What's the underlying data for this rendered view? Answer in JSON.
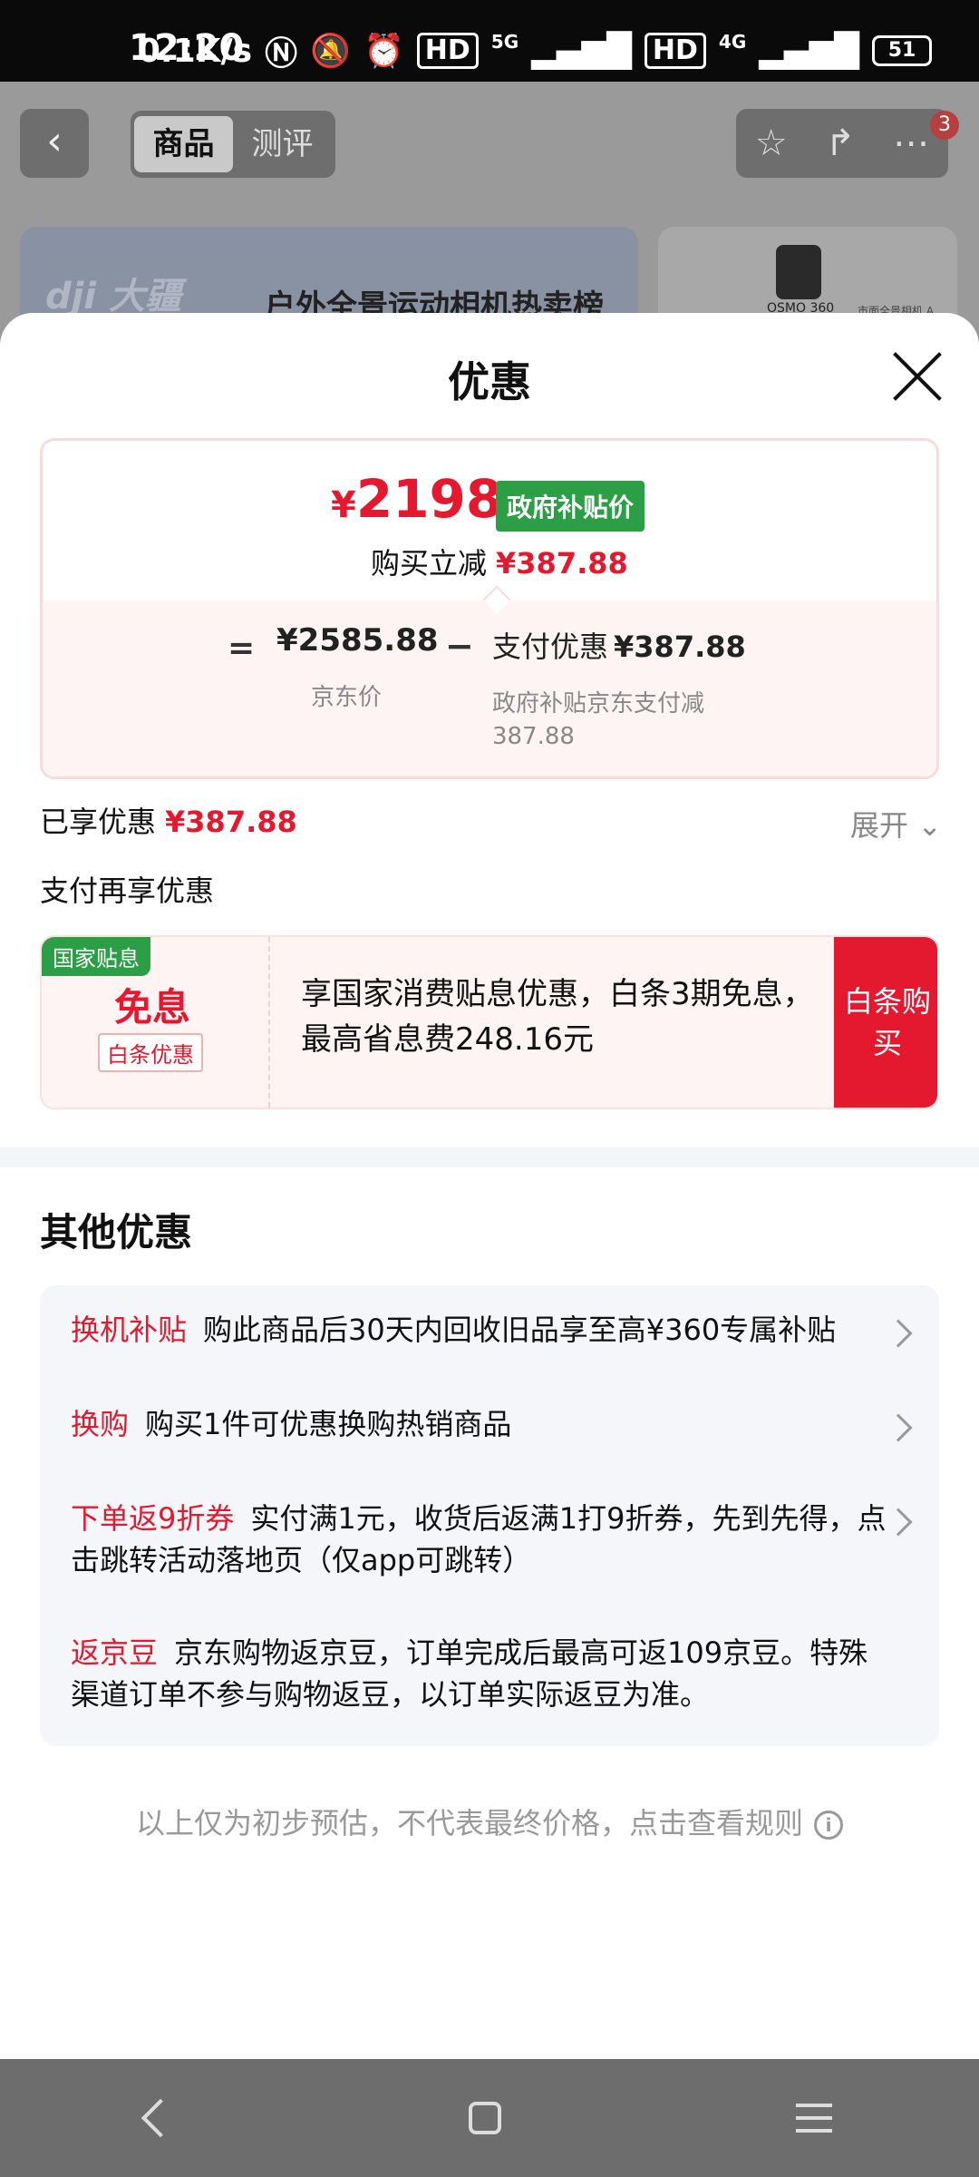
{
  "status_bar": {
    "time": "12:20",
    "speed": "0.1K/s",
    "net1": "5G",
    "net2": "4G",
    "hd": "HD",
    "battery": "51"
  },
  "background_page": {
    "tabs": [
      "商品",
      "测评"
    ],
    "badge_count": "3",
    "brand_logo": "dji 大疆",
    "banner_text": "户外全景运动相机热卖榜",
    "thumb_label": "OSMO 360",
    "thumb_label2": "市面全景相机 A"
  },
  "sheet": {
    "title": "优惠",
    "price": {
      "yen": "¥",
      "value": "2198",
      "gov_tag": "政府补贴价",
      "reduce_label": "购买立减",
      "reduce_amount": "¥387.88",
      "equals": "=",
      "jd_price": "¥2585.88",
      "jd_label": "京东价",
      "minus": "−",
      "pay_discount_label": "支付优惠",
      "pay_discount_amount": "¥387.88",
      "pay_discount_desc": "政府补贴京东支付减387.88"
    },
    "enjoyed_label": "已享优惠",
    "enjoyed_amount": "¥387.88",
    "expand_label": "展开",
    "pay_again_label": "支付再享优惠",
    "promo": {
      "tag": "国家贴息",
      "free": "免息",
      "baitiao_tag": "白条优惠",
      "text": "享国家消费贴息优惠，白条3期免息，最高省息费248.16元",
      "button": "白条购买"
    },
    "other_title": "其他优惠",
    "other_items": [
      {
        "tag": "换机补贴",
        "text": "购此商品后30天内回收旧品享至高¥360专属补贴"
      },
      {
        "tag": "换购",
        "text": "购买1件可优惠换购热销商品"
      },
      {
        "tag": "下单返9折券",
        "text": "实付满1元，收货后返满1打9折券，先到先得，点击跳转活动落地页（仅app可跳转）"
      },
      {
        "tag": "返京豆",
        "text": "京东购物返京豆，订单完成后最高可返109京豆。特殊渠道订单不参与购物返豆，以订单实际返豆为准。"
      }
    ],
    "footnote": "以上仅为初步预估，不代表最终价格，点击查看规则",
    "info_icon": "i"
  },
  "colors": {
    "accent_red": "#e4192f",
    "gov_green": "#2c9e46"
  }
}
